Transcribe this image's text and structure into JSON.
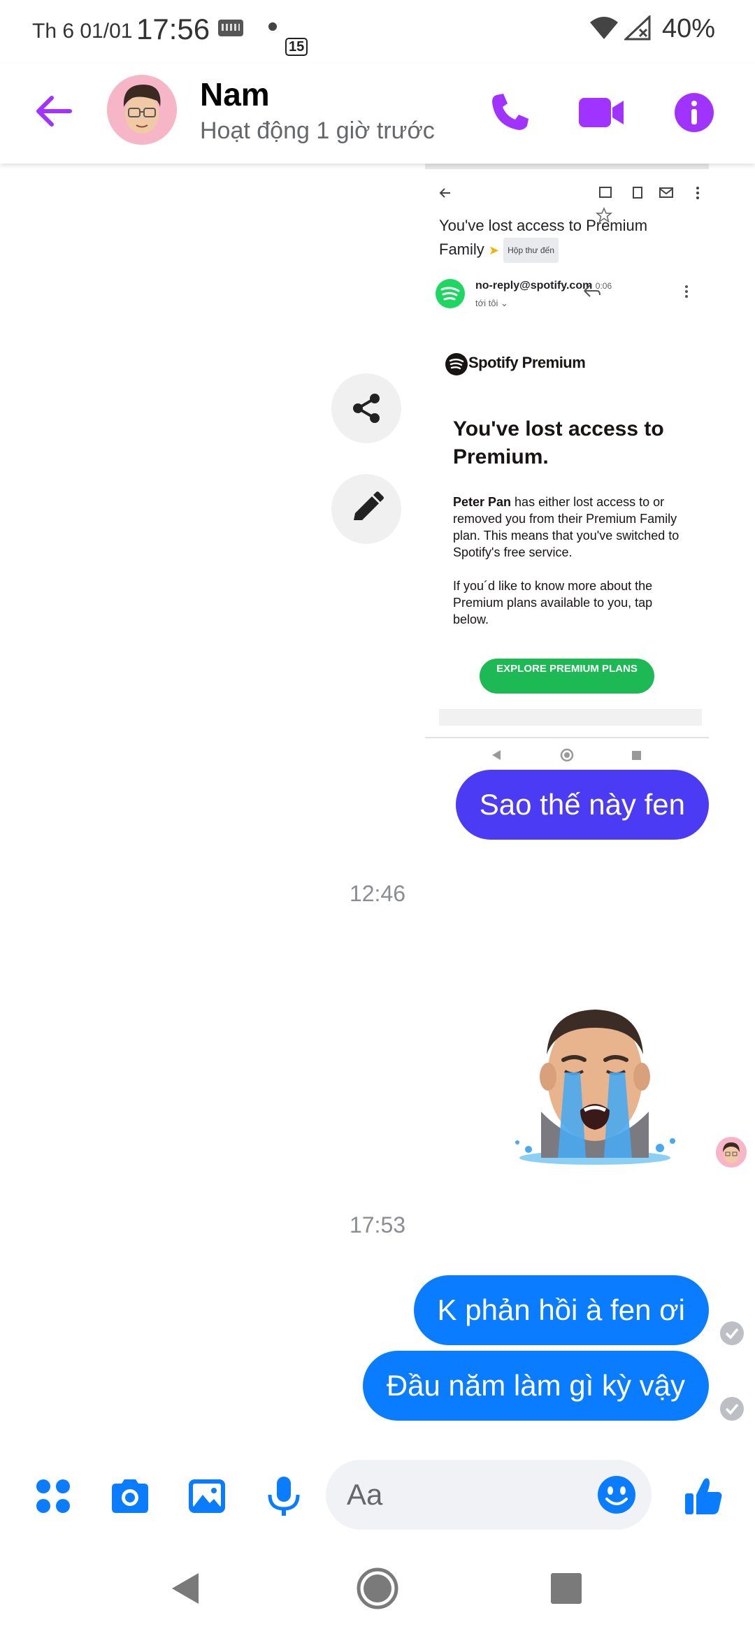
{
  "status_bar": {
    "date": "Th 6 01/01",
    "time": "17:56",
    "notification_count": "15",
    "battery": "40%"
  },
  "header": {
    "contact_name": "Nam",
    "contact_status": "Hoạt động 1 giờ trước"
  },
  "shared_image": {
    "subject_line1": "You've lost access to Premium",
    "subject_line2": "Family",
    "inbox_label": "Hộp thư đến",
    "sender": "no-reply@spotify.com",
    "sent_time": "0:06",
    "to_label": "tới tôi",
    "brand": "Spotify Premium",
    "headline": "You've lost access to Premium.",
    "body_name": "Peter Pan",
    "body_p1": " has either lost access to or removed you from their Premium Family plan. This means that you've switched to Spotify's free service.",
    "body_p2": "If you´d like to know more about the Premium plans available to you, tap below.",
    "cta_label": "EXPLORE PREMIUM PLANS"
  },
  "messages": [
    {
      "text": "Sao thế này fen",
      "color": "#4b3bf5"
    },
    {
      "timestamp": "12:46"
    },
    {
      "sticker": "crying-memoji-sticker"
    },
    {
      "timestamp": "17:53"
    },
    {
      "text": "K phản hồi à fen ơi",
      "color": "#0a7cff"
    },
    {
      "text": "Đầu năm làm gì kỳ vậy",
      "color": "#0a7cff"
    }
  ],
  "composer": {
    "placeholder": "Aa"
  },
  "theme": {
    "header_accent": "#a033ff",
    "composer_accent": "#0a7cff"
  },
  "icons": [
    "back-arrow-icon",
    "phone-icon",
    "video-camera-icon",
    "info-icon",
    "share-icon",
    "pencil-icon",
    "apps-icon",
    "camera-icon",
    "gallery-icon",
    "microphone-icon",
    "emoji-icon",
    "thumbs-up-icon",
    "nav-back-icon",
    "nav-home-icon",
    "nav-recents-icon"
  ]
}
